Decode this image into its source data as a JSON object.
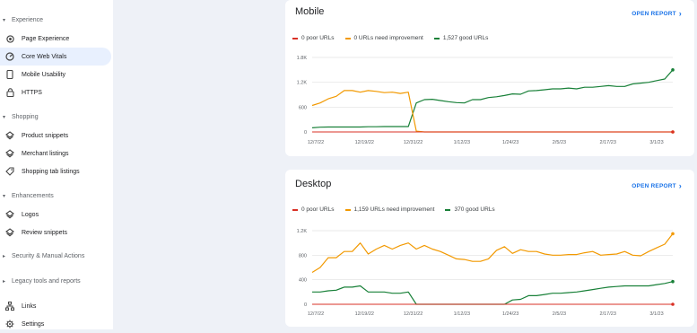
{
  "sidebar": {
    "sections": [
      {
        "label": "Experience",
        "items": [
          "Page Experience",
          "Core Web Vitals",
          "Mobile Usability",
          "HTTPS"
        ]
      },
      {
        "label": "Shopping",
        "items": [
          "Product snippets",
          "Merchant listings",
          "Shopping tab listings"
        ]
      },
      {
        "label": "Enhancements",
        "items": [
          "Logos",
          "Review snippets"
        ]
      },
      {
        "label": "Security & Manual Actions",
        "items": []
      },
      {
        "label": "Legacy tools and reports",
        "items": []
      }
    ],
    "bottom_items": [
      "Links",
      "Settings"
    ],
    "active_item": "Core Web Vitals"
  },
  "open_report_label": "OPEN REPORT",
  "colors": {
    "poor": "#d93025",
    "needs": "#f29900",
    "good": "#188038",
    "accent": "#1a73e8"
  },
  "charts": [
    {
      "title": "Mobile",
      "legend": [
        "0 poor URLs",
        "0 URLs need improvement",
        "1,527 good URLs"
      ],
      "y_ticks": [
        "1.8K",
        "1.2K",
        "600",
        "0"
      ],
      "x_ticks": [
        "12/7/22",
        "12/19/22",
        "12/31/22",
        "1/12/23",
        "1/24/23",
        "2/5/23",
        "2/17/23",
        "3/1/23"
      ]
    },
    {
      "title": "Desktop",
      "legend": [
        "0 poor URLs",
        "1,159 URLs need improvement",
        "370 good URLs"
      ],
      "y_ticks": [
        "1.2K",
        "800",
        "400",
        "0"
      ],
      "x_ticks": [
        "12/7/22",
        "12/19/22",
        "12/31/22",
        "1/12/23",
        "1/24/23",
        "2/5/23",
        "2/17/23",
        "3/1/23"
      ]
    }
  ],
  "chart_data": [
    {
      "type": "line",
      "title": "Mobile",
      "x_start": "12/7/22",
      "x_end": "3/7/23",
      "ylim": [
        0,
        1800
      ],
      "series": [
        {
          "name": "0 poor URLs",
          "values": [
            0,
            0,
            0,
            0,
            0,
            0,
            0,
            0,
            0,
            0,
            0,
            0,
            0,
            0,
            0,
            0,
            0,
            0,
            0,
            0,
            0,
            0,
            0,
            0,
            0,
            0,
            0,
            0,
            0,
            0,
            0,
            0,
            0,
            0,
            0,
            0,
            0,
            0,
            0,
            0,
            0,
            0,
            0,
            0,
            0,
            0
          ]
        },
        {
          "name": "0 URLs need improvement",
          "values": [
            640,
            700,
            800,
            860,
            1000,
            1000,
            960,
            1000,
            980,
            950,
            960,
            930,
            960,
            20,
            0,
            0,
            0,
            0,
            0,
            0,
            0,
            0,
            0,
            0,
            0,
            0,
            0,
            0,
            0,
            0,
            0,
            0,
            0,
            0,
            0,
            0,
            0,
            0,
            0,
            0,
            0,
            0,
            0,
            0,
            0,
            0
          ]
        },
        {
          "name": "1,527 good URLs",
          "values": [
            100,
            115,
            120,
            120,
            120,
            120,
            120,
            125,
            125,
            130,
            130,
            130,
            130,
            700,
            780,
            790,
            760,
            730,
            710,
            700,
            780,
            780,
            830,
            850,
            880,
            920,
            910,
            990,
            1000,
            1020,
            1040,
            1040,
            1060,
            1040,
            1080,
            1080,
            1100,
            1120,
            1100,
            1100,
            1160,
            1180,
            1200,
            1240,
            1280,
            1500
          ]
        }
      ]
    },
    {
      "type": "line",
      "title": "Desktop",
      "x_start": "12/7/22",
      "x_end": "3/7/23",
      "ylim": [
        0,
        1200
      ],
      "series": [
        {
          "name": "0 poor URLs",
          "values": [
            0,
            0,
            0,
            0,
            0,
            0,
            0,
            0,
            0,
            0,
            0,
            0,
            0,
            0,
            0,
            0,
            0,
            0,
            0,
            0,
            0,
            0,
            0,
            0,
            0,
            0,
            0,
            0,
            0,
            0,
            0,
            0,
            0,
            0,
            0,
            0,
            0,
            0,
            0,
            0,
            0,
            0,
            0,
            0,
            0,
            0
          ]
        },
        {
          "name": "1,159 URLs need improvement",
          "values": [
            520,
            600,
            760,
            760,
            860,
            860,
            1000,
            820,
            900,
            960,
            900,
            960,
            1000,
            900,
            960,
            900,
            860,
            800,
            740,
            730,
            700,
            700,
            740,
            880,
            940,
            830,
            890,
            860,
            860,
            820,
            800,
            800,
            810,
            810,
            840,
            860,
            800,
            810,
            820,
            860,
            800,
            790,
            860,
            920,
            980,
            1150
          ]
        },
        {
          "name": "370 good URLs",
          "values": [
            200,
            200,
            220,
            230,
            280,
            280,
            300,
            200,
            200,
            200,
            180,
            180,
            200,
            0,
            0,
            0,
            0,
            0,
            0,
            0,
            0,
            0,
            0,
            0,
            0,
            70,
            80,
            140,
            140,
            160,
            180,
            180,
            190,
            200,
            220,
            240,
            260,
            280,
            290,
            300,
            300,
            300,
            300,
            320,
            340,
            370
          ]
        }
      ]
    }
  ]
}
